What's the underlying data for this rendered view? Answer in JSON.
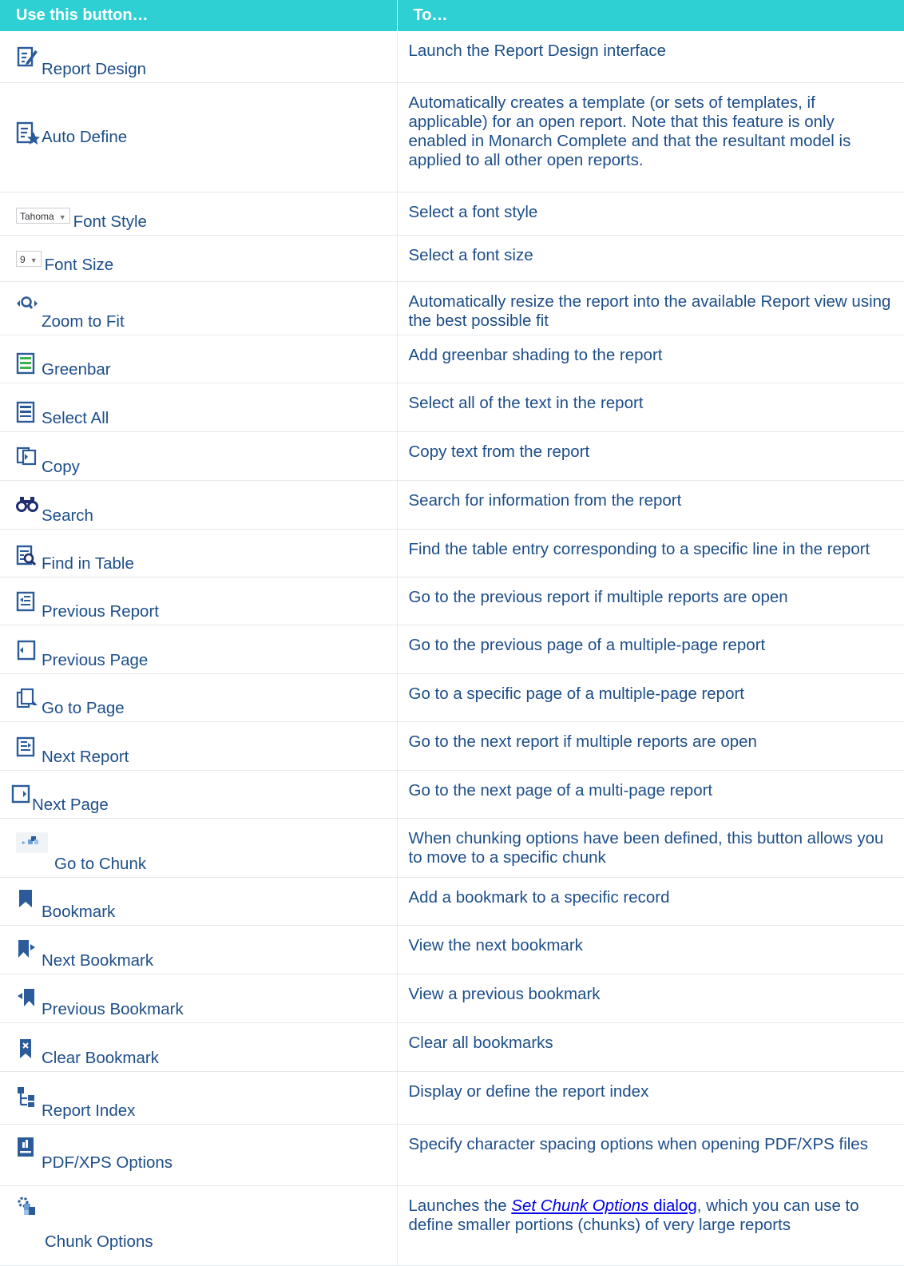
{
  "header": {
    "col1": "Use this button…",
    "col2": "To…"
  },
  "rows": [
    {
      "label": "Report Design",
      "desc": "Launch the Report Design interface"
    },
    {
      "label": "Auto Define",
      "desc": "Automatically creates a template (or sets of templates, if applicable) for an open report. Note that this feature is only enabled in Monarch Complete and that the resultant model is applied to all other open reports."
    },
    {
      "label": "Font Style",
      "control": "Tahoma",
      "desc": "Select a font style"
    },
    {
      "label": "Font Size",
      "control": "9",
      "desc": "Select a font size"
    },
    {
      "label": "Zoom to Fit",
      "desc": "Automatically resize the report into the available Report view using the best possible fit"
    },
    {
      "label": "Greenbar",
      "desc": "Add greenbar shading to the report"
    },
    {
      "label": "Select All",
      "desc": "Select all of the text in the report"
    },
    {
      "label": "Copy",
      "desc": "Copy text from the report"
    },
    {
      "label": "Search",
      "desc": "Search for information from the report"
    },
    {
      "label": "Find in Table",
      "desc": "Find the table entry corresponding to a specific line in the report"
    },
    {
      "label": "Previous Report",
      "desc": "Go to the previous report if multiple reports are open"
    },
    {
      "label": "Previous Page",
      "desc": "Go to the previous page of a multiple-page report"
    },
    {
      "label": "Go to Page",
      "desc": "Go to a specific page of a multiple-page report"
    },
    {
      "label": "Next Report",
      "desc": "Go to the next report if multiple reports are open"
    },
    {
      "label": "Next Page",
      "desc": "Go to the next page of a multi-page report"
    },
    {
      "label": "Go to Chunk",
      "desc": "When chunking options have been defined, this button allows you to move to a specific chunk"
    },
    {
      "label": "Bookmark",
      "desc": "Add a bookmark to a specific record"
    },
    {
      "label": "Next Bookmark",
      "desc": "View the next bookmark"
    },
    {
      "label": "Previous Bookmark",
      "desc": "View a previous bookmark"
    },
    {
      "label": "Clear Bookmark",
      "desc": "Clear all bookmarks"
    },
    {
      "label": "Report Index",
      "desc": "Display or define the report index"
    },
    {
      "label": "PDF/XPS Options",
      "desc": "Specify character spacing options when opening PDF/XPS files"
    },
    {
      "label": "Chunk Options",
      "desc_pre": "Launches the ",
      "link_italic": "Set Chunk Options",
      "link_plain": " dialog",
      "desc_post": ", which you can use to define smaller portions (chunks) of very large reports"
    }
  ],
  "colors": {
    "header_bg": "#2ed0d4",
    "text": "#1d4e89",
    "icon": "#2b5b99",
    "link": "#0000ee"
  }
}
